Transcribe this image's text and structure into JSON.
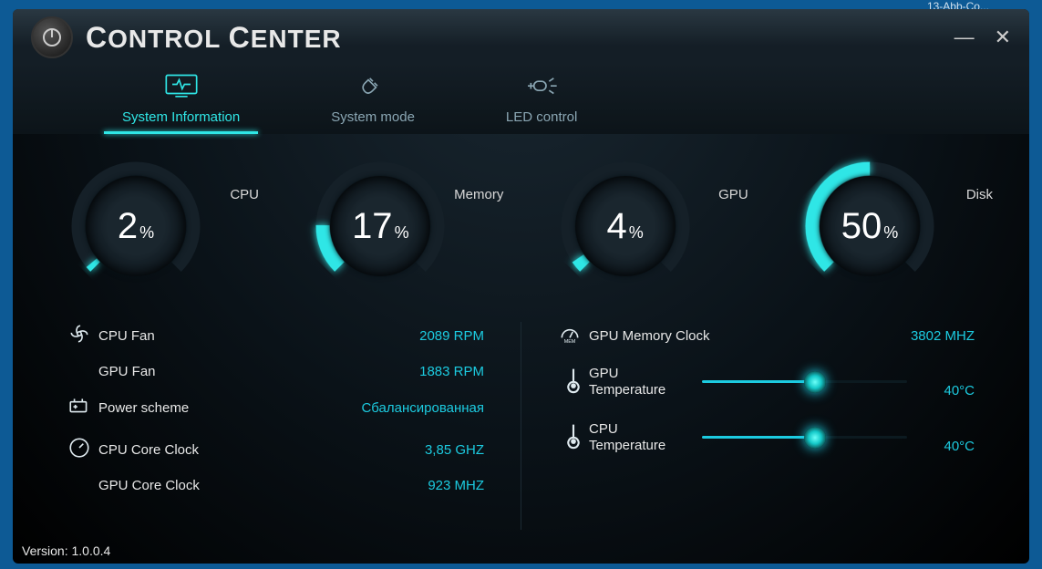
{
  "desktop": {
    "taskbar_hint": "13-Abb-Co..."
  },
  "header": {
    "title_html": "Control Center"
  },
  "tabs": [
    {
      "label": "System Information",
      "active": true
    },
    {
      "label": "System mode",
      "active": false
    },
    {
      "label": "LED control",
      "active": false
    }
  ],
  "gauges": {
    "cpu": {
      "label": "CPU",
      "value": 2,
      "unit": "%"
    },
    "memory": {
      "label": "Memory",
      "value": 17,
      "unit": "%"
    },
    "gpu": {
      "label": "GPU",
      "value": 4,
      "unit": "%"
    },
    "disk": {
      "label": "Disk",
      "value": 50,
      "unit": "%"
    }
  },
  "stats_left": {
    "cpu_fan": {
      "label": "CPU Fan",
      "value": "2089 RPM"
    },
    "gpu_fan": {
      "label": "GPU Fan",
      "value": "1883 RPM"
    },
    "power_scheme": {
      "label": "Power scheme",
      "value": "Сбалансированная"
    },
    "cpu_core_clock": {
      "label": "CPU Core Clock",
      "value": "3,85 GHZ"
    },
    "gpu_core_clock": {
      "label": "GPU Core Clock",
      "value": "923 MHZ"
    }
  },
  "stats_right": {
    "gpu_mem_clock": {
      "label": "GPU Memory Clock",
      "value": "3802 MHZ"
    },
    "gpu_temp": {
      "label_l1": "GPU",
      "label_l2": "Temperature",
      "value": "40°C",
      "pct": 55
    },
    "cpu_temp": {
      "label_l1": "CPU",
      "label_l2": "Temperature",
      "value": "40°C",
      "pct": 55
    }
  },
  "footer": {
    "version_label": "Version: 1.0.0.4"
  }
}
